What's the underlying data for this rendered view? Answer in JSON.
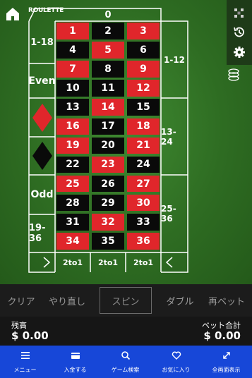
{
  "header": {
    "logo_main": "ROULETTE",
    "logo_sub": ""
  },
  "table": {
    "zero": "0",
    "numbers": [
      [
        "1",
        "2",
        "3"
      ],
      [
        "4",
        "5",
        "6"
      ],
      [
        "7",
        "8",
        "9"
      ],
      [
        "10",
        "11",
        "12"
      ],
      [
        "13",
        "14",
        "15"
      ],
      [
        "16",
        "17",
        "18"
      ],
      [
        "19",
        "20",
        "21"
      ],
      [
        "22",
        "23",
        "24"
      ],
      [
        "25",
        "26",
        "27"
      ],
      [
        "28",
        "29",
        "30"
      ],
      [
        "31",
        "32",
        "33"
      ],
      [
        "34",
        "35",
        "36"
      ]
    ],
    "colors": [
      [
        "red",
        "black",
        "red"
      ],
      [
        "black",
        "red",
        "black"
      ],
      [
        "red",
        "black",
        "red"
      ],
      [
        "black",
        "black",
        "red"
      ],
      [
        "black",
        "red",
        "black"
      ],
      [
        "red",
        "black",
        "red"
      ],
      [
        "red",
        "black",
        "red"
      ],
      [
        "black",
        "red",
        "black"
      ],
      [
        "red",
        "black",
        "red"
      ],
      [
        "black",
        "black",
        "red"
      ],
      [
        "black",
        "red",
        "black"
      ],
      [
        "red",
        "black",
        "red"
      ]
    ],
    "left_bets": {
      "low": "1-18",
      "even": "Even",
      "odd": "Odd",
      "high": "19-36"
    },
    "dozens": {
      "first": "1-12",
      "second": "13-24",
      "third": "25-36"
    },
    "columns": [
      "2to1",
      "2to1",
      "2to1"
    ],
    "red_color": "#e0262b",
    "black_color": "#0a0a0a"
  },
  "actions": {
    "clear": "クリア",
    "undo": "やり直し",
    "spin": "スピン",
    "double": "ダブル",
    "rebet": "再ベット"
  },
  "balance": {
    "label": "残高",
    "value": "$ 0.00"
  },
  "total_bet": {
    "label": "ベット合計",
    "value": "$ 0.00"
  },
  "nav": {
    "menu": "メニュー",
    "deposit": "入金する",
    "search": "ゲーム検索",
    "favorites": "お気に入り",
    "fullscreen": "全画面表示"
  },
  "nav_color": "#1747d8"
}
